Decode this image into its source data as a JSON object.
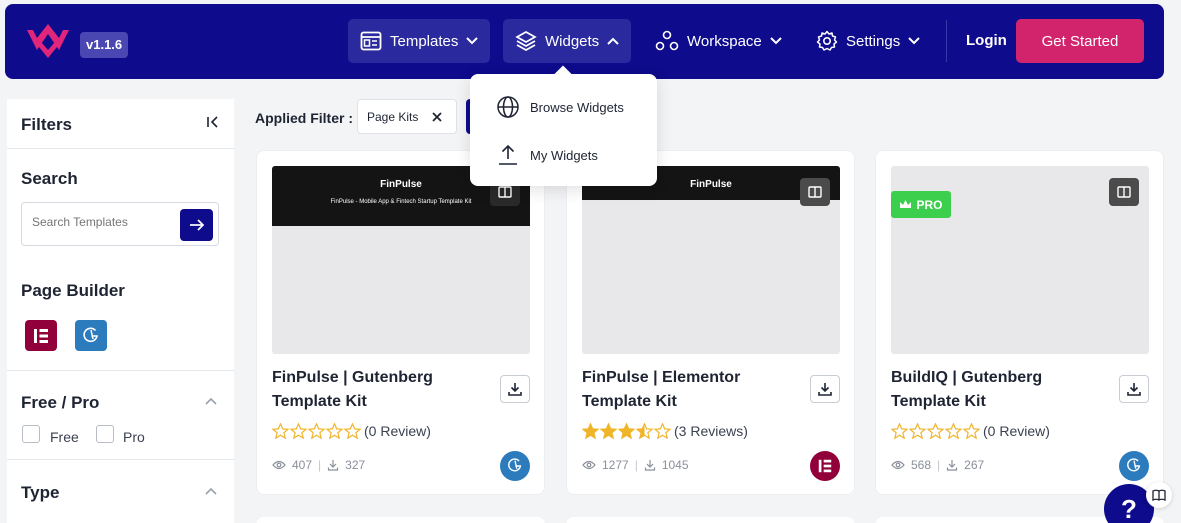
{
  "header": {
    "version": "v1.1.6",
    "nav": [
      {
        "label": "Templates"
      },
      {
        "label": "Widgets"
      },
      {
        "label": "Workspace"
      },
      {
        "label": "Settings"
      }
    ],
    "login": "Login",
    "get_started": "Get Started",
    "colors": {
      "nav_bg": "#0e0b8c",
      "accent": "#d1246d"
    }
  },
  "widgets_menu": {
    "items": [
      {
        "label": "Browse Widgets",
        "icon": "globe-icon"
      },
      {
        "label": "My Widgets",
        "icon": "upload-icon"
      }
    ]
  },
  "sidebar": {
    "title": "Filters",
    "search": {
      "title": "Search",
      "placeholder": "Search Templates"
    },
    "page_builder": {
      "title": "Page Builder",
      "options": [
        "elementor-icon",
        "gutenberg-icon"
      ]
    },
    "free_pro": {
      "title": "Free / Pro",
      "options": [
        "Free",
        "Pro"
      ]
    },
    "type": {
      "title": "Type"
    }
  },
  "applied_filter": {
    "label": "Applied Filter :",
    "chips": [
      "Page Kits"
    ]
  },
  "cards": [
    {
      "title": "FinPulse | Gutenberg Template Kit",
      "brand": "FinPulse",
      "subtitle": "FinPulse - Mobile App & Fintech Startup Template Kit",
      "rating": 0,
      "reviews": "(0 Review)",
      "views": "407",
      "downloads": "327",
      "builder": "gutenberg",
      "pro": false
    },
    {
      "title": "FinPulse | Elementor Template Kit",
      "brand": "FinPulse",
      "subtitle": "",
      "rating": 3.5,
      "reviews": "(3 Reviews)",
      "views": "1277",
      "downloads": "1045",
      "builder": "elementor",
      "pro": false
    },
    {
      "title": "BuildIQ | Gutenberg Template Kit",
      "brand": "",
      "subtitle": "",
      "rating": 0,
      "reviews": "(0 Review)",
      "views": "568",
      "downloads": "267",
      "builder": "gutenberg",
      "pro": true,
      "pro_label": "PRO"
    }
  ],
  "help": {
    "label": "?"
  }
}
